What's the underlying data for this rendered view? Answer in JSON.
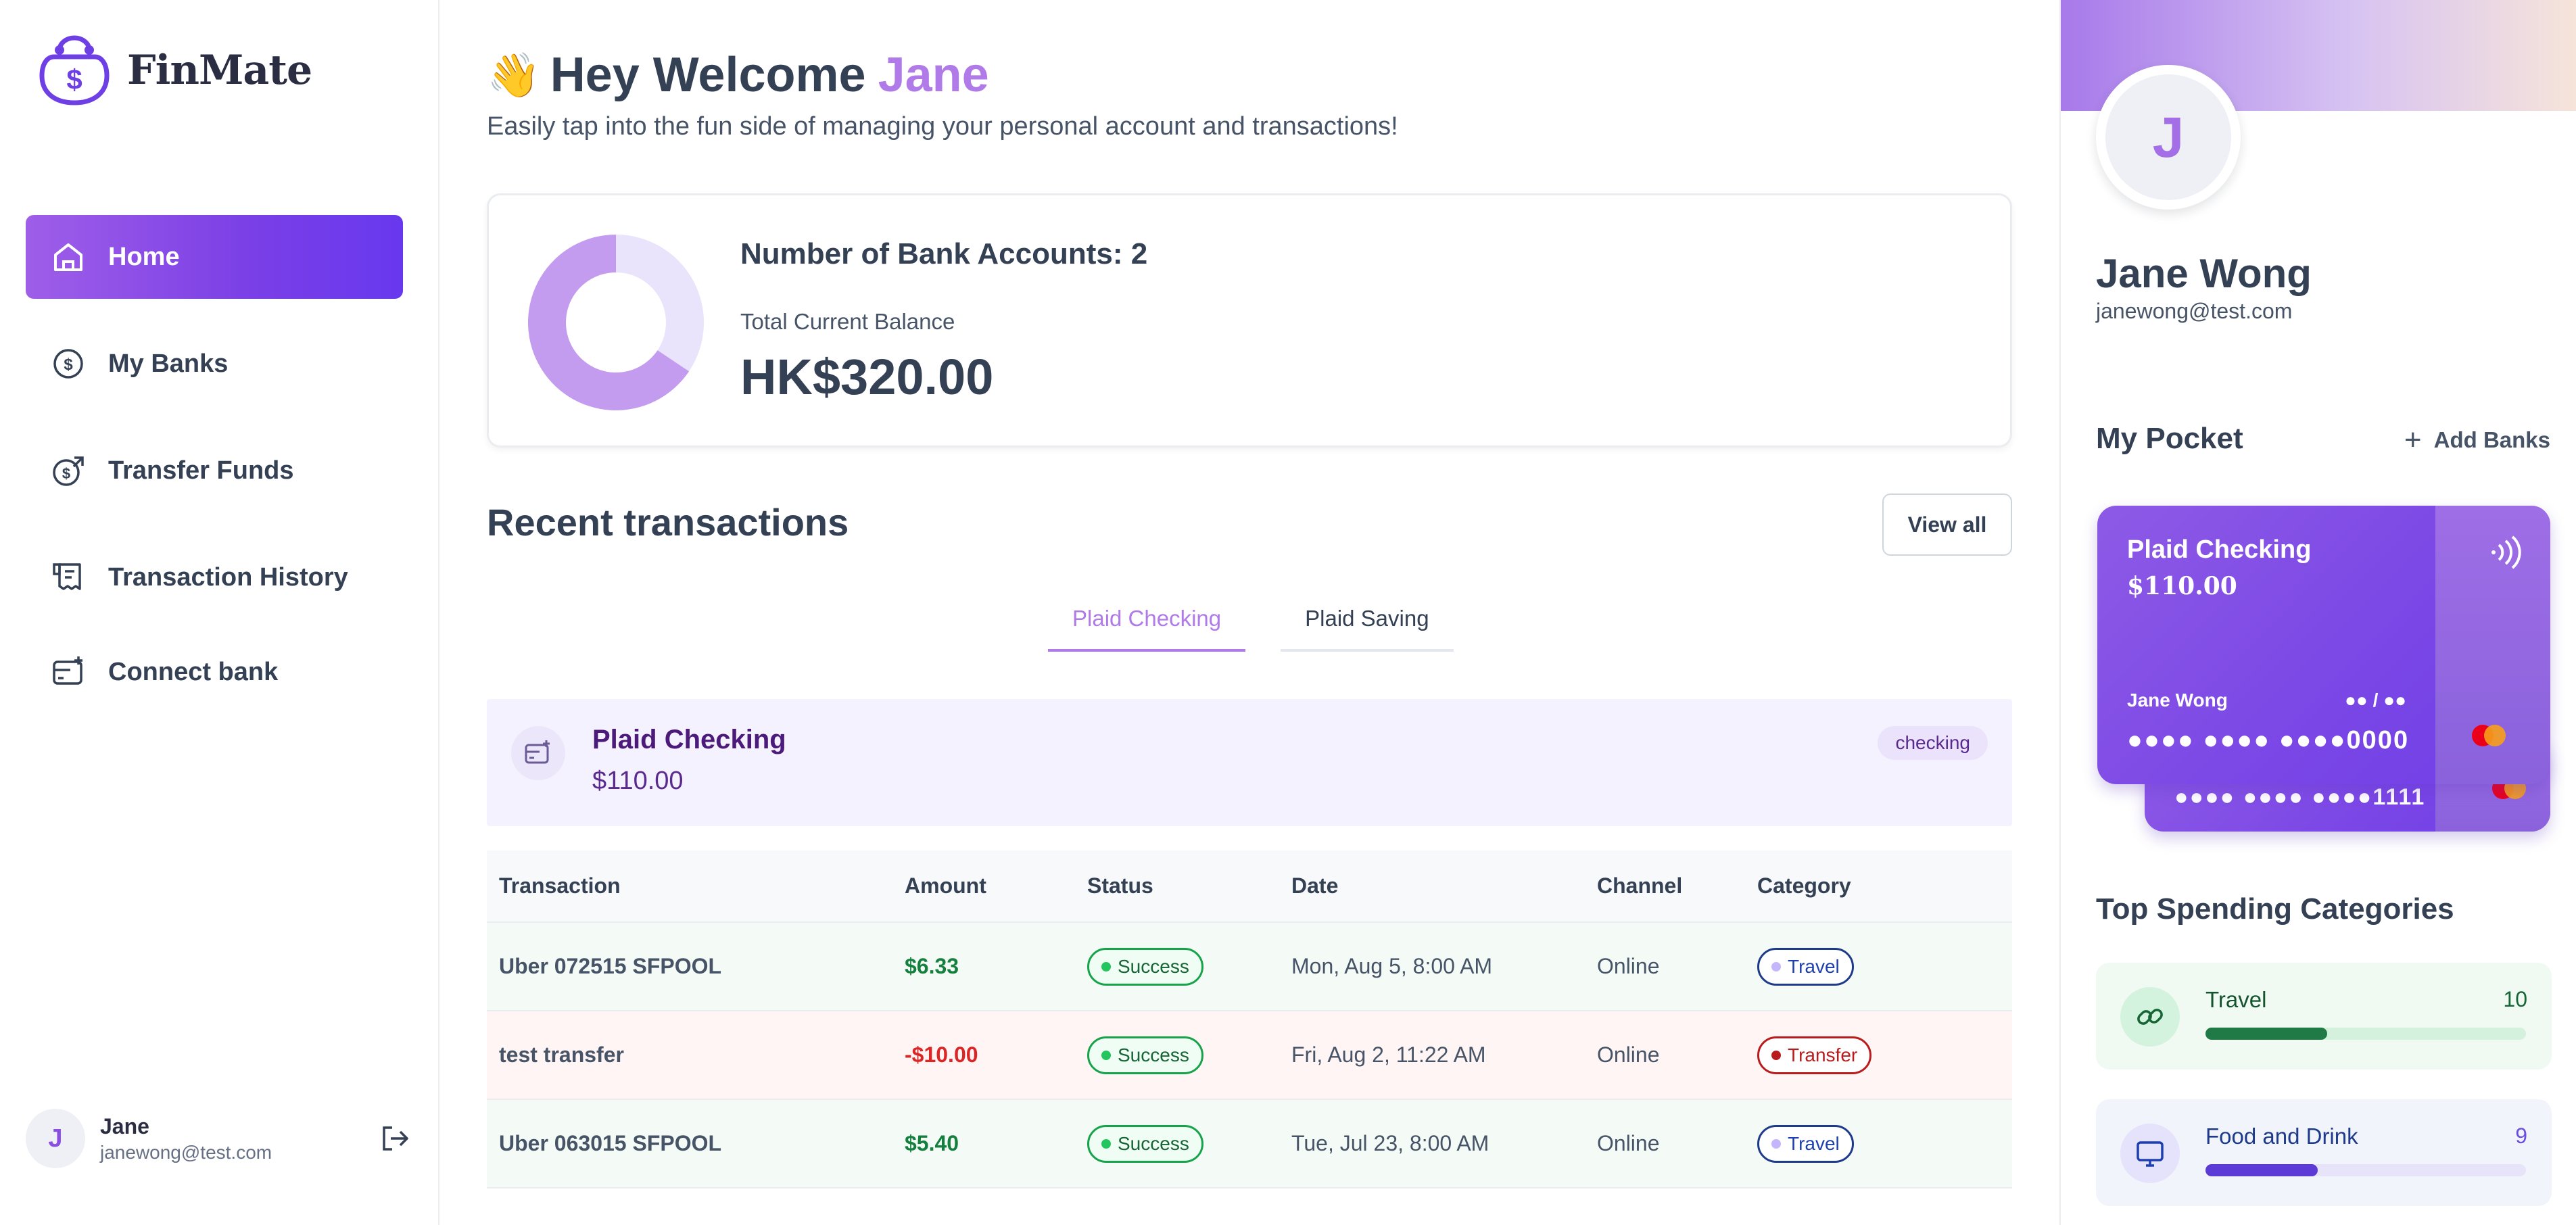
{
  "brand": {
    "name": "FinMate",
    "accent": "#7a46e6"
  },
  "sidebar": {
    "items": [
      {
        "label": "Home",
        "icon": "home-icon",
        "active": true
      },
      {
        "label": "My Banks",
        "icon": "dollar-circle-icon"
      },
      {
        "label": "Transfer Funds",
        "icon": "money-send-icon"
      },
      {
        "label": "Transaction History",
        "icon": "receipt-icon"
      },
      {
        "label": "Connect bank",
        "icon": "card-add-icon"
      }
    ],
    "user": {
      "initial": "J",
      "name": "Jane",
      "email": "janewong@test.com"
    }
  },
  "header": {
    "wave": "👋",
    "greeting": "Hey Welcome",
    "name": "Jane",
    "subtitle": "Easily tap into the fun side of managing your personal account and transactions!"
  },
  "balance": {
    "accounts_label": "Number of Bank Accounts: 2",
    "total_label": "Total Current Balance",
    "total": "HK$320.00",
    "chart_data": {
      "type": "pie",
      "categories": [
        "Plaid Checking",
        "Plaid Saving"
      ],
      "values": [
        110,
        210
      ],
      "colors": [
        "#e9e3fb",
        "#c39cf0"
      ]
    }
  },
  "recent": {
    "title": "Recent transactions",
    "view_all": "View all",
    "tabs": [
      {
        "label": "Plaid Checking",
        "active": true
      },
      {
        "label": "Plaid Saving",
        "active": false
      }
    ],
    "account": {
      "name": "Plaid Checking",
      "balance": "$110.00",
      "type": "checking"
    },
    "columns": [
      "Transaction",
      "Amount",
      "Status",
      "Date",
      "Channel",
      "Category"
    ],
    "rows": [
      {
        "name": "Uber 072515 SFPOOL",
        "amount": "$6.33",
        "status": "Success",
        "date": "Mon, Aug 5, 8:00 AM",
        "channel": "Online",
        "category": "Travel",
        "kind": "pos"
      },
      {
        "name": "test transfer",
        "amount": "-$10.00",
        "status": "Success",
        "date": "Fri, Aug 2, 11:22 AM",
        "channel": "Online",
        "category": "Transfer",
        "kind": "neg"
      },
      {
        "name": "Uber 063015 SFPOOL",
        "amount": "$5.40",
        "status": "Success",
        "date": "Tue, Jul 23, 8:00 AM",
        "channel": "Online",
        "category": "Travel",
        "kind": "pos"
      }
    ]
  },
  "profile": {
    "initial": "J",
    "name": "Jane Wong",
    "email": "janewong@test.com",
    "pocket_title": "My Pocket",
    "add_banks": "Add Banks",
    "cards": [
      {
        "title": "Plaid Checking",
        "balance": "$110.00",
        "holder": "Jane Wong",
        "expiry": "●● / ●●",
        "number": "●●●● ●●●● ●●●●0000"
      },
      {
        "number": "●●●● ●●●● ●●●●1111"
      }
    ]
  },
  "categories": {
    "title": "Top Spending Categories",
    "items": [
      {
        "name": "Travel",
        "count": "10",
        "progress": 0.38,
        "icon": "link-icon"
      },
      {
        "name": "Food and Drink",
        "count": "9",
        "progress": 0.35,
        "icon": "monitor-icon"
      }
    ]
  }
}
